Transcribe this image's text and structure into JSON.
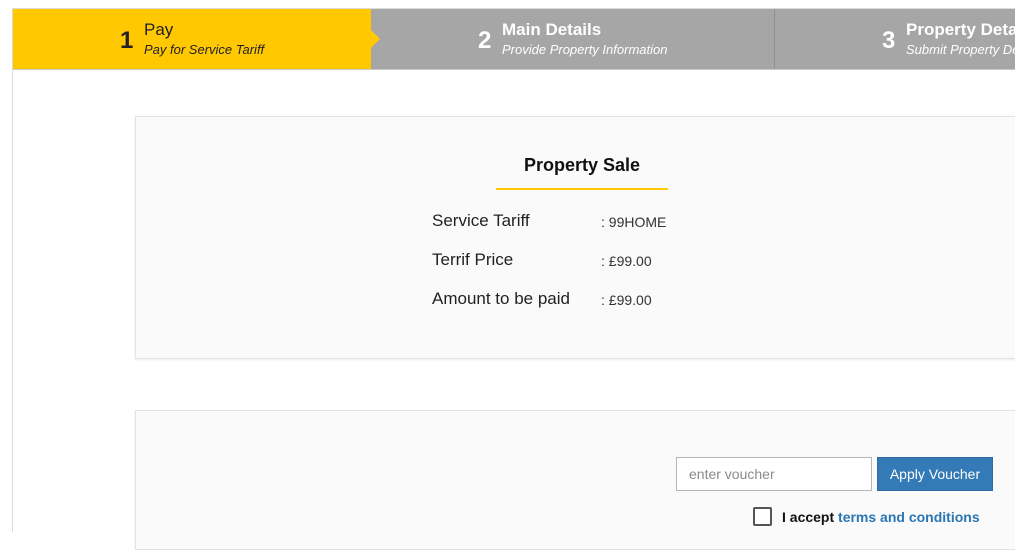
{
  "wizard": {
    "steps": [
      {
        "number": "1",
        "title": "Pay",
        "subtitle": "Pay for Service Tariff",
        "state": "active"
      },
      {
        "number": "2",
        "title": "Main Details",
        "subtitle": "Provide Property Information",
        "state": "inactive"
      },
      {
        "number": "3",
        "title": "Property Details",
        "subtitle": "Submit Property Details",
        "state": "inactive"
      }
    ],
    "colors": {
      "active": "#ffc800",
      "inactive": "#a6a6a6"
    }
  },
  "summary": {
    "title": "Property Sale",
    "rows": [
      {
        "label": "Service Tariff",
        "value": ": 99HOME"
      },
      {
        "label": "Terrif Price",
        "value": ": £99.00"
      },
      {
        "label": "Amount to be paid",
        "value": ": £99.00"
      }
    ]
  },
  "voucher": {
    "placeholder": "enter voucher",
    "value": "",
    "apply_label": "Apply Voucher",
    "terms_prefix": "I accept",
    "terms_link": "terms and conditions",
    "terms_checked": false
  }
}
